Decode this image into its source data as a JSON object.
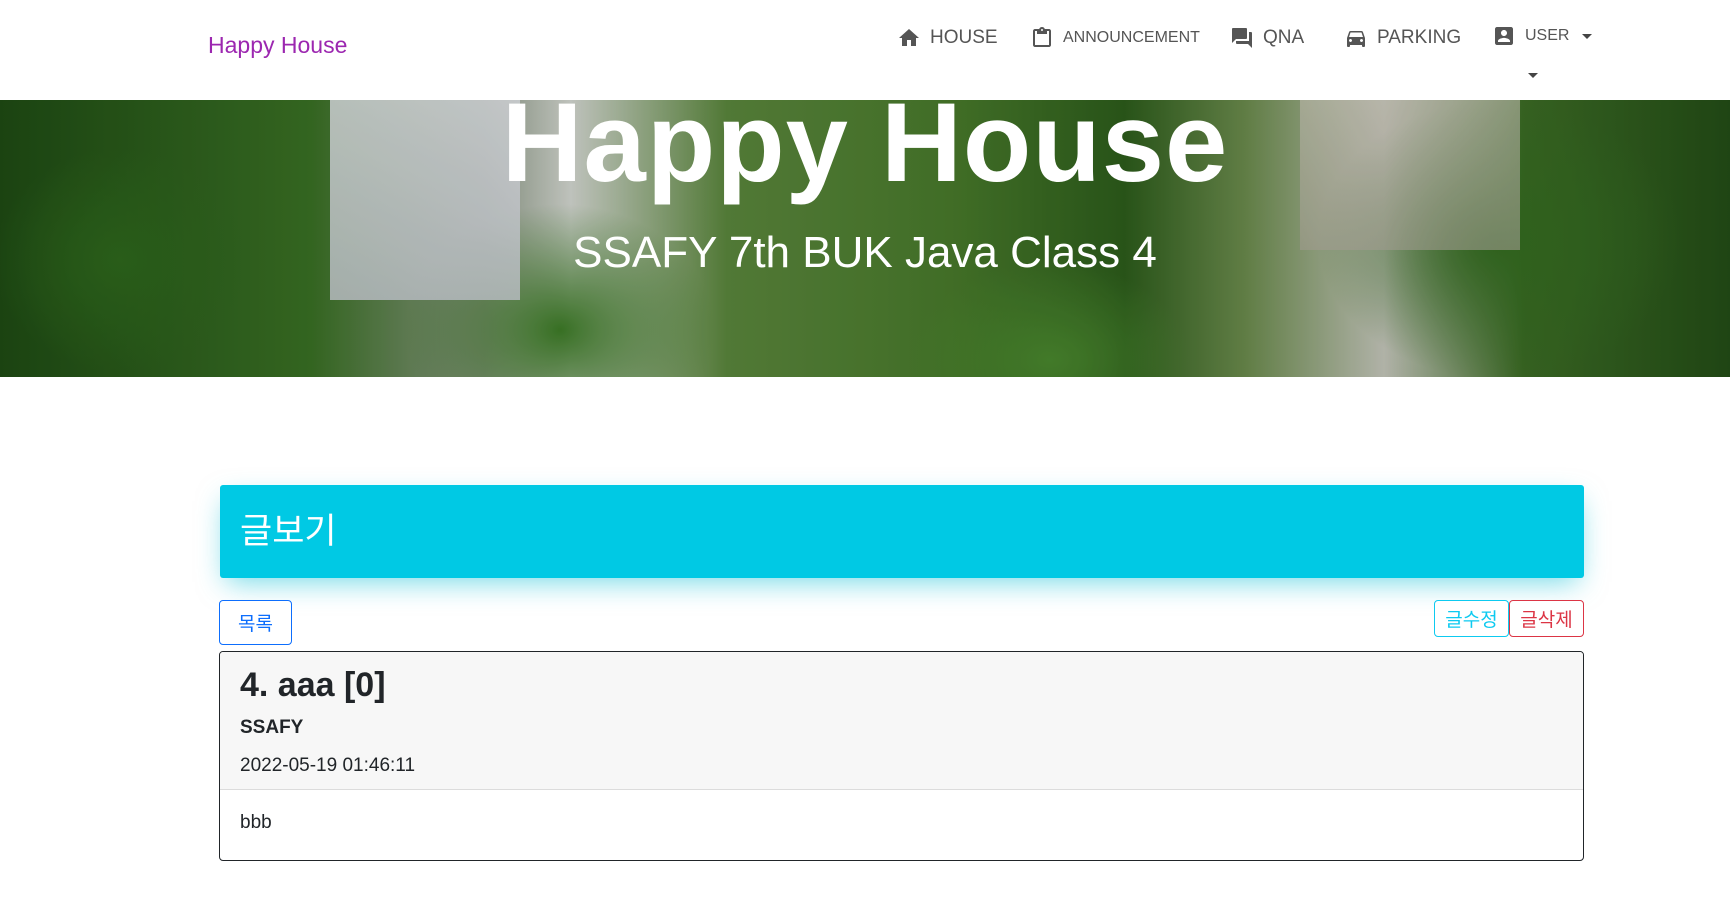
{
  "navbar": {
    "brand": "Happy House",
    "items": [
      {
        "label": "HOUSE",
        "icon": "home-icon"
      },
      {
        "label": "ANNOUNCEMENT",
        "icon": "clipboard-icon"
      },
      {
        "label": "QNA",
        "icon": "chat-icon"
      },
      {
        "label": "PARKING",
        "icon": "car-icon"
      },
      {
        "label": "USER",
        "icon": "account-box-icon"
      }
    ]
  },
  "hero": {
    "title": "Happy House",
    "subtitle": "SSAFY 7th BUK Java Class 4"
  },
  "board": {
    "header": "글보기",
    "list_button": "목록",
    "edit_button": "글수정",
    "delete_button": "글삭제"
  },
  "post": {
    "title": "4. aaa [0]",
    "author": "SSAFY",
    "date": "2022-05-19 01:46:11",
    "content": "bbb"
  },
  "colors": {
    "brand": "#9c27b0",
    "header_bg": "#00c9e4",
    "primary": "#0d6efd",
    "info": "#0dcaf0",
    "danger": "#dc3545"
  }
}
